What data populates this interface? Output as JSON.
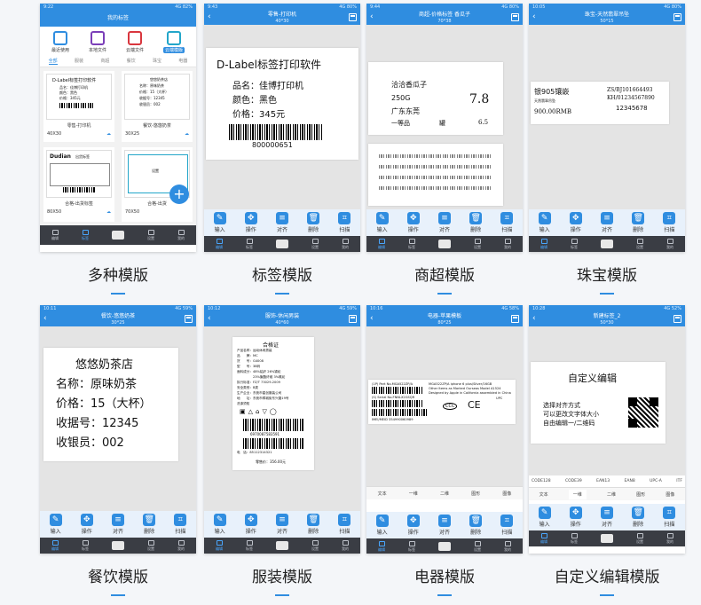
{
  "captions": [
    "多种模版",
    "标签模版",
    "商超模版",
    "珠宝模版",
    "餐饮模版",
    "服装模版",
    "电器模版",
    "自定义编辑模版"
  ],
  "tools": [
    "输入",
    "操作",
    "对齐",
    "删除",
    "扫描"
  ],
  "nav": [
    "编辑",
    "标签",
    "设置",
    "我的"
  ],
  "icons": {
    "input": "pencil-icon",
    "op": "move-icon",
    "align": "align-icon",
    "del": "trash-icon",
    "scan": "scan-icon"
  },
  "accent": "#2f8de0",
  "s1": {
    "status_time": "9:22",
    "status_right": "4G 82%",
    "title": "我的标签",
    "quick": [
      "最近使用",
      "本地文件",
      "云端文件",
      "云端模版"
    ],
    "filters": [
      "全部",
      "服装",
      "商超",
      "餐饮",
      "珠宝",
      "电器"
    ],
    "cards": [
      {
        "name": "零售-打印机",
        "size": "40X30",
        "preview_title": "D-Label标签打印软件",
        "preview_lines": [
          "品名：佳博打印机",
          "颜色：黑色",
          "价格：345元"
        ]
      },
      {
        "name": "餐饮-悠悠奶茶",
        "size": "30X25",
        "preview_title": "悠悠奶茶店",
        "preview_lines": [
          "名称：原味奶茶",
          "价格：15（大杯）",
          "收据号：12345",
          "收银员：002"
        ]
      },
      {
        "name": "合格-出货标签",
        "size": "80X50",
        "preview_title": "Dudian",
        "preview_lines": [
          "出货标签"
        ]
      },
      {
        "name": "合格-出货",
        "size": "70X50",
        "preview_title": "",
        "preview_lines": [
          "设置"
        ]
      }
    ],
    "fab": "+"
  },
  "s2": {
    "status_time": "9:43",
    "status_right": "4G 80%",
    "title": "零售-打印机",
    "sub": "40*30",
    "heading": "D-Label标签打印软件",
    "lines": [
      "品名：佳博打印机",
      "颜色：黑色",
      "价格：345元"
    ],
    "code": "800000651"
  },
  "s3": {
    "status_time": "9:44",
    "status_right": "4G 80%",
    "title": "商超-价格标签 香瓜子",
    "sub": "70*38",
    "name": "洽洽香瓜子",
    "weight": "250G",
    "origin": "广东东莞",
    "grade": "一等品",
    "unit": "罐",
    "price": "7.8",
    "price2": "6.5"
  },
  "s4": {
    "status_time": "10:05",
    "status_right": "4G 80%",
    "title": "珠宝-天然翡翠吊坠",
    "sub": "50*15",
    "line1": "银905镶嵌",
    "line2": "天然翡翠吊坠",
    "line3": "900.00RMB",
    "code1": "ZS/BJ101664493",
    "code2": "KH/01234567890",
    "code3": "12345678"
  },
  "s5": {
    "status_time": "10:11",
    "status_right": "4G 59%",
    "title": "餐饮-悠悠奶茶",
    "sub": "30*25",
    "heading": "悠悠奶茶店",
    "lines": [
      "名称：原味奶茶",
      "价格：15（大杯）",
      "收据号：12345",
      "收银员：002"
    ]
  },
  "s6": {
    "status_time": "10:12",
    "status_right": "4G 59%",
    "title": "服饰-休闲男装",
    "sub": "40*60",
    "heading": "合格证",
    "lines": [
      "产品名称：运动休闲男装",
      "品　　牌：MC",
      "货　　号：G4008",
      "型　　号：38码",
      "面料成分：48%粘纤 26%锦纶",
      "　　　　　23%聚酯纤维 3%氨纶",
      "执行标准：FZ/T 73029-2009",
      "安全类别：B类",
      "生产企业：东莞市星创服装公司",
      "地　　址：东莞市樟城街东兴路19号",
      "洗涤须知"
    ],
    "code": "6970087583591",
    "tel": "电　话：85112314321",
    "price": "零售价：356.00元"
  },
  "s7": {
    "status_time": "10:16",
    "status_right": "4G 58%",
    "title": "电器-苹果模板",
    "sub": "80*25",
    "l1": "(1P) Part No.MGA522ZP/A",
    "l2": "(S) Serial No.FNNLX2GSQR",
    "l3": "MGA522ZP/A iphone 6 plus/Silver/16GB",
    "l4": "Other Items as Marked Ourseas Model A1524",
    "l5": "Designed by Apple in California assembled in China",
    "mark1": "CCC",
    "mark2": "CE",
    "upc": "UPC",
    "code": "IMEI/MEID 354990060989",
    "tabs": [
      "文本",
      "一维",
      "二维",
      "图形",
      "图像"
    ],
    "active_tab": "一维"
  },
  "s8": {
    "status_time": "10:28",
    "status_right": "4G 52%",
    "title": "新建标签_2",
    "sub": "50*30",
    "heading": "自定义编辑",
    "lines": [
      "选择对齐方式",
      "可以更改文字体大小",
      "自由编辑一/二维码"
    ],
    "codes": [
      "CODE128",
      "CODE39",
      "EAN13",
      "EAN8",
      "UPC-A",
      "ITF"
    ],
    "tabs": [
      "文本",
      "一维",
      "二维",
      "图形",
      "图像"
    ],
    "active_tab": "一维"
  }
}
